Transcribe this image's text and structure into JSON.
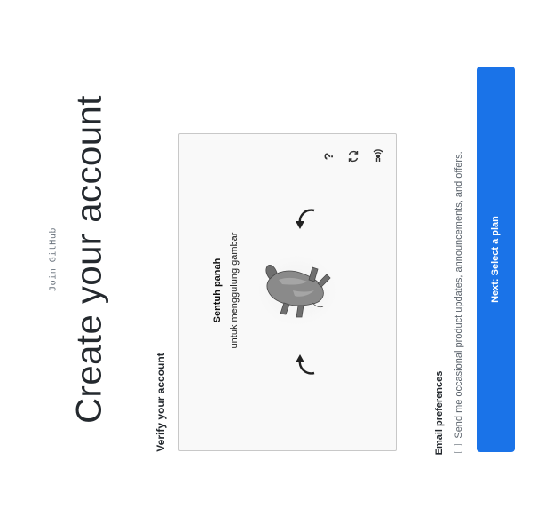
{
  "header": {
    "eyebrow": "Join GitHub",
    "title": "Create your account"
  },
  "verify": {
    "heading": "Verify your account",
    "instruction_bold": "Sentuh panah",
    "instruction": "untuk menggulung gambar",
    "icons": [
      "audio-icon",
      "refresh-icon",
      "help-icon",
      "rotate-left-arrow-icon",
      "rotate-right-arrow-icon"
    ]
  },
  "preferences": {
    "heading": "Email preferences",
    "checkbox_label": "Send me occasional product updates, announcements, and offers.",
    "checked": false
  },
  "actions": {
    "next_label": "Next: Select a plan"
  },
  "colors": {
    "primary": "#1a73e8",
    "title": "#24292e",
    "muted": "#586069"
  }
}
